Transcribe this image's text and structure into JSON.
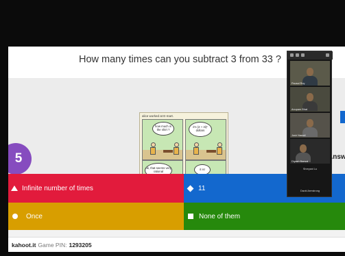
{
  "question": {
    "text": "How many times can you subtract 3 from 33 ?"
  },
  "timer": {
    "value": "5"
  },
  "comic": {
    "caption": "alice worked at E-mart.",
    "panel1_bubble": "how much is the shirt ?",
    "panel2_bubble": "it's (2 + 3i)² dollars",
    "panel3_bubble": "ok, that seems very rational",
    "panel4_bubble": "it is!"
  },
  "answers": {
    "red": "Infinite number of times",
    "blue": "11",
    "yellow": "Once",
    "green": "None of them"
  },
  "side": {
    "answers_label": "Answ"
  },
  "footer": {
    "site": "kahoot.it",
    "pin_label": "Game PIN:",
    "pin": "1293205"
  },
  "zoom": {
    "participants": [
      {
        "name": "Pausal Roy"
      },
      {
        "name": "Anupam Bhat"
      },
      {
        "name": "Josh Nawali"
      },
      {
        "name": "Diyash Bansal"
      }
    ],
    "extra_names": [
      "Shreyani Lu",
      "David Armstrong"
    ]
  },
  "colors": {
    "red": "#e21b3c",
    "blue": "#1368ce",
    "yellow": "#d89e00",
    "green": "#26890c",
    "purple": "#864cbf"
  }
}
